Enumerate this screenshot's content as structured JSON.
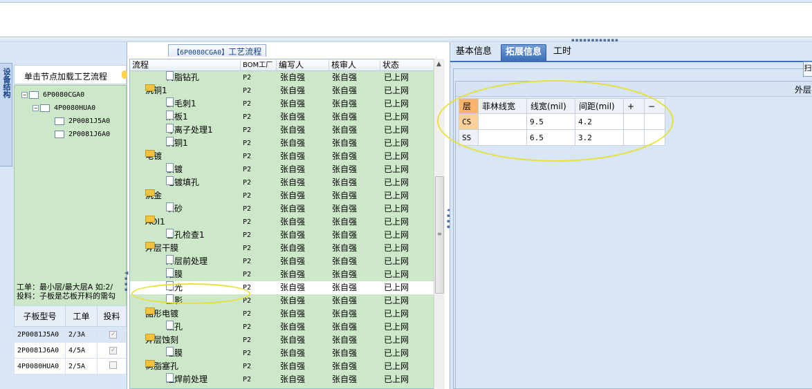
{
  "left_panel": {
    "side_tab_label": "设备结构",
    "header_text": "单击节点加载工艺流程",
    "tree": [
      {
        "label": "6P0080CGA0",
        "level": 0,
        "expanded": true
      },
      {
        "label": "4P0080HUA0",
        "level": 1,
        "expanded": true
      },
      {
        "label": "2P0081J5A0",
        "level": 2
      },
      {
        "label": "2P0081J6A0",
        "level": 2
      }
    ],
    "info_line1": "工单：最小层/最大层A 如:2/",
    "info_line2": "投料：子板是芯板开料的需勾",
    "sub_table": {
      "headers": [
        "子板型号",
        "工单",
        "投料"
      ],
      "rows": [
        {
          "model": "2P0081J5A0",
          "order": "2/3A",
          "checked": true
        },
        {
          "model": "2P0081J6A0",
          "order": "4/5A",
          "checked": true
        },
        {
          "model": "4P0080HUA0",
          "order": "2/5A",
          "checked": false
        }
      ]
    }
  },
  "middle_panel": {
    "title_code": "【6P0080CGA0】",
    "title_text": "工艺流程",
    "columns": [
      "流程",
      "BOM工厂",
      "编写人",
      "核审人",
      "状态"
    ],
    "rows": [
      {
        "name": "树脂钻孔",
        "type": "doc",
        "level": 1,
        "bom": "P2",
        "author": "张自强",
        "reviewer": "张自强",
        "status": "已上网"
      },
      {
        "name": "沉铜1",
        "type": "folder",
        "level": 0,
        "bom": "P2",
        "author": "张自强",
        "reviewer": "张自强",
        "status": "已上网"
      },
      {
        "name": "去毛刺1",
        "type": "doc",
        "level": 1,
        "bom": "P2",
        "author": "张自强",
        "reviewer": "张自强",
        "status": "已上网"
      },
      {
        "name": "烘板1",
        "type": "doc",
        "level": 1,
        "bom": "P2",
        "author": "张自强",
        "reviewer": "张自强",
        "status": "已上网"
      },
      {
        "name": "等离子处理1",
        "type": "doc",
        "level": 1,
        "bom": "P2",
        "author": "张自强",
        "reviewer": "张自强",
        "status": "已上网"
      },
      {
        "name": "沉铜1",
        "type": "doc",
        "level": 1,
        "bom": "P2",
        "author": "张自强",
        "reviewer": "张自强",
        "status": "已上网"
      },
      {
        "name": "电镀",
        "type": "folder",
        "level": 0,
        "bom": "P2",
        "author": "张自强",
        "reviewer": "张自强",
        "status": "已上网"
      },
      {
        "name": "板镀",
        "type": "doc",
        "level": 1,
        "bom": "P2",
        "author": "张自强",
        "reviewer": "张自强",
        "status": "已上网"
      },
      {
        "name": "电镀填孔",
        "type": "doc",
        "level": 1,
        "bom": "P2",
        "author": "张自强",
        "reviewer": "张自强",
        "status": "已上网"
      },
      {
        "name": "沉金",
        "type": "folder",
        "level": 0,
        "bom": "P2",
        "author": "张自强",
        "reviewer": "张自强",
        "status": "已上网"
      },
      {
        "name": "喷砂",
        "type": "doc",
        "level": 1,
        "bom": "P2",
        "author": "张自强",
        "reviewer": "张自强",
        "status": "已上网"
      },
      {
        "name": "AOI1",
        "type": "folder",
        "level": 0,
        "bom": "P2",
        "author": "张自强",
        "reviewer": "张自强",
        "status": "已上网"
      },
      {
        "name": "盲孔检查1",
        "type": "doc",
        "level": 1,
        "bom": "P2",
        "author": "张自强",
        "reviewer": "张自强",
        "status": "已上网"
      },
      {
        "name": "外层干膜",
        "type": "folder",
        "level": 0,
        "bom": "P2",
        "author": "张自强",
        "reviewer": "张自强",
        "status": "已上网"
      },
      {
        "name": "外层前处理",
        "type": "doc",
        "level": 1,
        "bom": "P2",
        "author": "张自强",
        "reviewer": "张自强",
        "status": "已上网"
      },
      {
        "name": "贴膜",
        "type": "doc",
        "level": 1,
        "bom": "P2",
        "author": "张自强",
        "reviewer": "张自强",
        "status": "已上网"
      },
      {
        "name": "曝光",
        "type": "doc",
        "level": 1,
        "bom": "P2",
        "author": "张自强",
        "reviewer": "张自强",
        "status": "已上网",
        "selected": true
      },
      {
        "name": "显影",
        "type": "doc",
        "level": 1,
        "bom": "P2",
        "author": "张自强",
        "reviewer": "张自强",
        "status": "已上网"
      },
      {
        "name": "图形电镀",
        "type": "folder",
        "level": 0,
        "bom": "P2",
        "author": "张自强",
        "reviewer": "张自强",
        "status": "已上网"
      },
      {
        "name": "镀孔",
        "type": "doc",
        "level": 1,
        "bom": "P2",
        "author": "张自强",
        "reviewer": "张自强",
        "status": "已上网"
      },
      {
        "name": "外层蚀刻",
        "type": "folder",
        "level": 0,
        "bom": "P2",
        "author": "张自强",
        "reviewer": "张自强",
        "status": "已上网"
      },
      {
        "name": "退膜",
        "type": "doc",
        "level": 1,
        "bom": "P2",
        "author": "张自强",
        "reviewer": "张自强",
        "status": "已上网"
      },
      {
        "name": "树脂塞孔",
        "type": "folder",
        "level": 0,
        "bom": "P2",
        "author": "张自强",
        "reviewer": "张自强",
        "status": "已上网"
      },
      {
        "name": "阻焊前处理",
        "type": "doc",
        "level": 1,
        "bom": "P2",
        "author": "张自强",
        "reviewer": "张自强",
        "status": "已上网"
      }
    ]
  },
  "right_panel": {
    "tabs": [
      {
        "label": "基本信息",
        "active": false
      },
      {
        "label": "拓展信息",
        "active": true
      },
      {
        "label": "工时",
        "active": false
      }
    ],
    "corner_button_text": "扫",
    "sub_header_text": "外层",
    "layer_table": {
      "headers": [
        "层",
        "菲林线宽",
        "线宽(mil)",
        "间距(mil)",
        "+",
        "−"
      ],
      "rows": [
        {
          "layer": "CS",
          "film": "",
          "width": "9.5",
          "spacing": "4.2"
        },
        {
          "layer": "SS",
          "film": "",
          "width": "6.5",
          "spacing": "3.2"
        }
      ]
    }
  },
  "colors": {
    "grid_green": "#cde7c9",
    "panel_blue": "#d9e6f6",
    "tab_active": "#3f6fb6",
    "highlight_ellipse": "#e8e03a",
    "layer_cell_orange": "#fbd09a"
  }
}
